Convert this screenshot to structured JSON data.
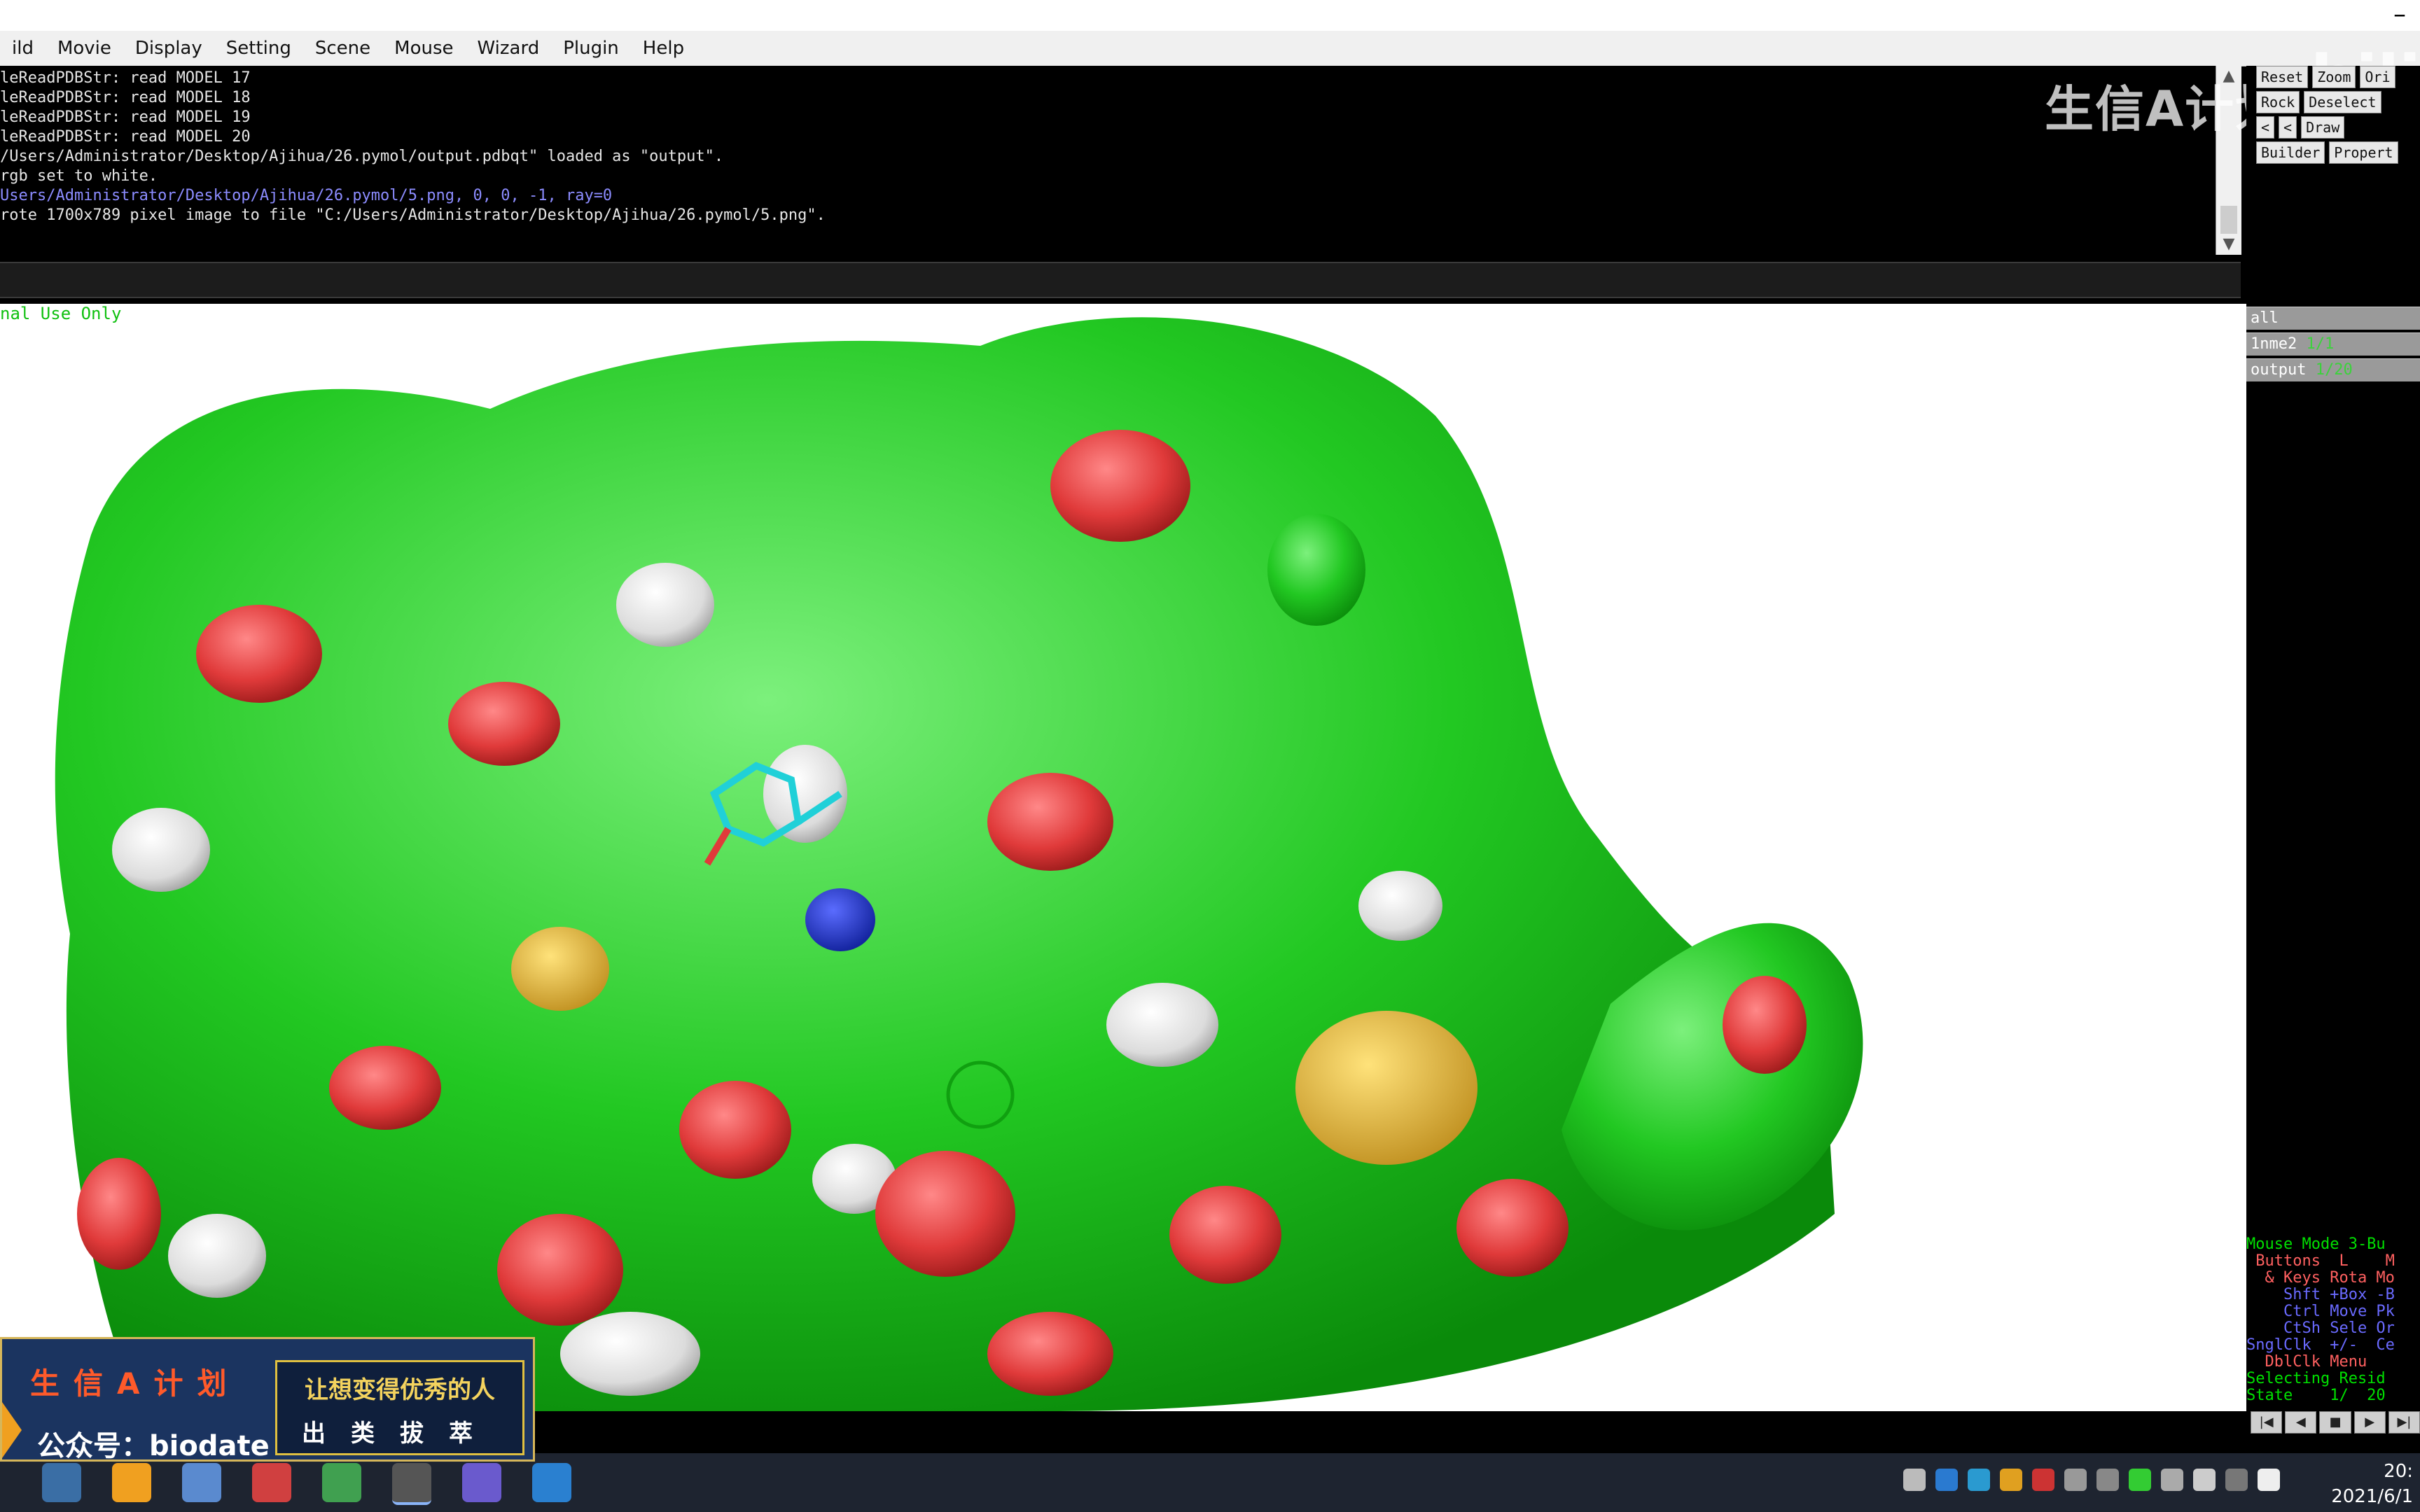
{
  "window": {
    "minimize_glyph": "–"
  },
  "menu": [
    "ild",
    "Movie",
    "Display",
    "Setting",
    "Scene",
    "Mouse",
    "Wizard",
    "Plugin",
    "Help"
  ],
  "console": {
    "lines": [
      {
        "text": "leReadPDBStr: read MODEL 17",
        "style": "normal"
      },
      {
        "text": "leReadPDBStr: read MODEL 18",
        "style": "normal"
      },
      {
        "text": "leReadPDBStr: read MODEL 19",
        "style": "normal"
      },
      {
        "text": "leReadPDBStr: read MODEL 20",
        "style": "normal"
      },
      {
        "text": "/Users/Administrator/Desktop/Ajihua/26.pymol/output.pdbqt\" loaded as \"output\".",
        "style": "normal"
      },
      {
        "text": "rgb set to white.",
        "style": "normal"
      },
      {
        "text": "Users/Administrator/Desktop/Ajihua/26.pymol/5.png, 0, 0, -1, ray=0",
        "style": "blue"
      },
      {
        "text": "rote 1700x789 pixel image to file \"C:/Users/Administrator/Desktop/Ajihua/26.pymol/5.png\".",
        "style": "normal"
      }
    ]
  },
  "viewport": {
    "license_text": "nal Use Only"
  },
  "panel_buttons": {
    "row1": [
      "Reset",
      "Zoom",
      "Ori"
    ],
    "row2": [
      "Rock",
      "Deselect"
    ],
    "row3": [
      "<",
      "<",
      "Draw"
    ],
    "row4": [
      "Builder",
      "Propert"
    ]
  },
  "objects": [
    {
      "name": "all",
      "state": ""
    },
    {
      "name": "1nme2",
      "state": "1/1"
    },
    {
      "name": "output",
      "state": "1/20"
    }
  ],
  "mouse_help": {
    "title": "Mouse Mode 3-Bu",
    "buttons": " Buttons  L    M",
    "keys": "  & Keys Rota Mo",
    "shft": "    Shft +Box -B",
    "ctrl": "    Ctrl Move Pk",
    "ctsh": "    CtSh Sele Or",
    "sngl": "SnglClk  +/-  Ce",
    "dbl": "  DblClk Menu",
    "selecting": "Selecting Resid",
    "state": "State    1/  20"
  },
  "play_controls": [
    "|◀",
    "◀",
    "■",
    "▶",
    "▶|"
  ],
  "watermark": {
    "text": "生信A计划",
    "logo": "bili"
  },
  "banner": {
    "title": "生信A计划",
    "account": "公众号：biodate",
    "slogan": "让想变得优秀的人",
    "motto": "出类拔萃"
  },
  "clock": {
    "time": "20:",
    "date": "2021/6/1"
  },
  "colors": {
    "surface_green": "#2ecc2e",
    "surface_red": "#e04040",
    "surface_white": "#e6e6e6",
    "surface_blue": "#2030d0",
    "surface_yellow": "#e0b030",
    "ligand_cyan": "#20d0d8"
  }
}
